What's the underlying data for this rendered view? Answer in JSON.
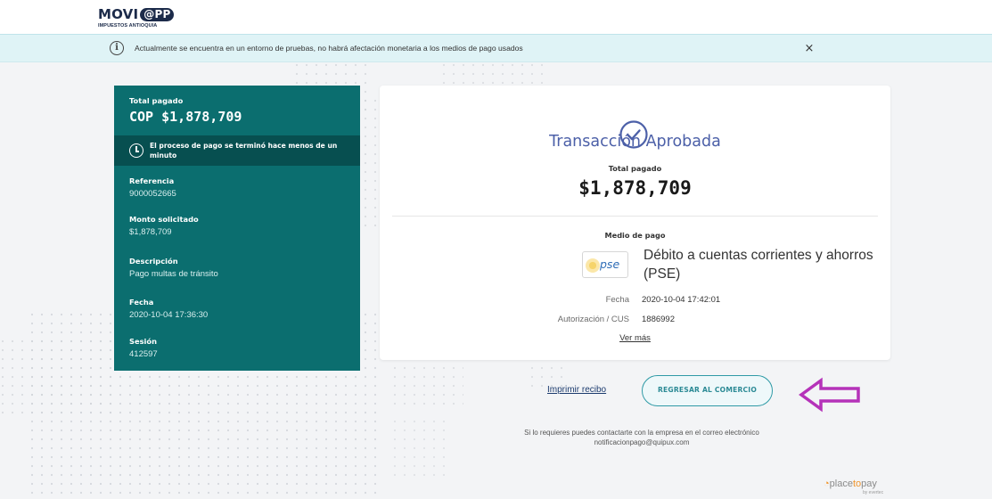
{
  "header": {
    "logo_main": "MOVI",
    "logo_pill": "@PP",
    "logo_sub": "IMPUESTOS ANTIOQUIA"
  },
  "notice": {
    "icon": "info-circle-icon",
    "text": "Actualmente se encuentra en un entorno de pruebas, no habrá afectación monetaria a los medios de pago usados",
    "close_label": "×"
  },
  "summary": {
    "total_label": "Total pagado",
    "total_value": "COP $1,878,709",
    "process_text": "El proceso de pago se terminó hace menos de un minuto",
    "fields": [
      {
        "label": "Referencia",
        "value": "9000052665"
      },
      {
        "label": "Monto solicitado",
        "value": "$1,878,709"
      },
      {
        "label": "Descripción",
        "value": "Pago multas de tránsito"
      },
      {
        "label": "Fecha",
        "value": "2020-10-04 17:36:30"
      },
      {
        "label": "Sesión",
        "value": "412597"
      }
    ]
  },
  "card": {
    "status_title": "Transacción Aprobada",
    "total_label": "Total pagado",
    "total_value": "$1,878,709",
    "payment_method_label": "Medio de pago",
    "payment_logo_text": "pse",
    "payment_method_name": "Débito a cuentas corrientes y ahorros (PSE)",
    "details": [
      {
        "label": "Fecha",
        "value": "2020-10-04 17:42:01"
      },
      {
        "label": "Autorización / CUS",
        "value": "1886992"
      }
    ],
    "more_link": "Ver más"
  },
  "actions": {
    "print_label": "Imprimir recibo",
    "return_label": "REGRESAR AL COMERCIO"
  },
  "contact": {
    "line1": "Si lo requieres puedes contactarte con la empresa en el correo electrónico",
    "email": "notificacionpago@quipux.com"
  },
  "footer": {
    "brand_a": "place",
    "brand_b": "to",
    "brand_c": "pay",
    "brand_sub": "by evertec"
  },
  "colors": {
    "summary_bg": "#0b6e6f",
    "summary_dark": "#074f50",
    "approved": "#4c60a8",
    "notice_bg": "#dff3f6",
    "button_border": "#2f9aa6",
    "arrow": "#b532b9"
  }
}
